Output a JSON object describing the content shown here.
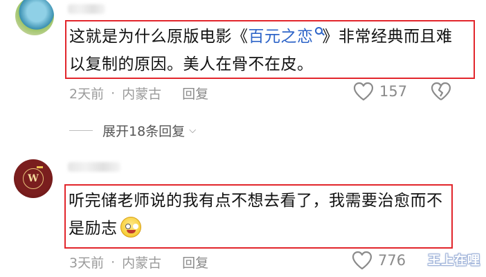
{
  "comments": [
    {
      "text_before": "这就是为什么原版电影《",
      "movie_link": "百元之恋",
      "text_after": "》非常经典而且难以复制的原因。美人在骨不在皮。",
      "time": "2天前",
      "separator": "·",
      "location": "内蒙古",
      "reply_label": "回复",
      "likes": "157",
      "expand_label": "展开18条回复"
    },
    {
      "text": "听完储老师说的我有点不想去看了，我需要治愈而不是励志",
      "emoji": "grinning-emoji",
      "time": "3天前",
      "separator": "·",
      "location": "内蒙古",
      "reply_label": "回复",
      "likes": "776"
    }
  ],
  "avatar2_letter": "W",
  "watermark": "王上在哩",
  "colors": {
    "highlight_border": "#e2252b",
    "link": "#2d64c8",
    "meta_text": "#9a9a9a"
  }
}
